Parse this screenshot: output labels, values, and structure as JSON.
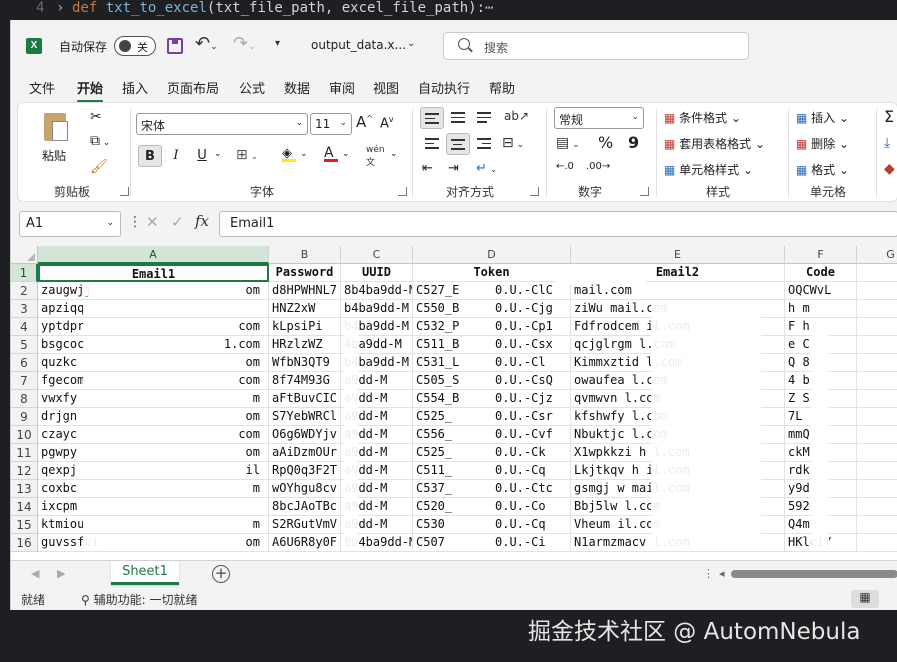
{
  "code": {
    "line_number": "4",
    "keyword": "def",
    "function": "txt_to_excel",
    "params": "(txt_file_path, excel_file_path):",
    "ellipsis": "⋯"
  },
  "titlebar": {
    "autosave_label": "自动保存",
    "toggle_state": "关",
    "filename": "output_data.x...",
    "search_placeholder": "搜索"
  },
  "tabs": [
    "文件",
    "开始",
    "插入",
    "页面布局",
    "公式",
    "数据",
    "审阅",
    "视图",
    "自动执行",
    "帮助"
  ],
  "active_tab": "开始",
  "ribbon": {
    "clipboard": {
      "paste": "粘贴",
      "group": "剪贴板"
    },
    "font": {
      "name": "宋体",
      "size": "11",
      "group": "字体",
      "bold": "B",
      "italic": "I",
      "underline": "U",
      "grow": "A",
      "shrink": "A",
      "wen": "wén"
    },
    "alignment": {
      "group": "对齐方式"
    },
    "number": {
      "format": "常规",
      "percent": "%",
      "comma": "9",
      "group": "数字"
    },
    "styles": {
      "conditional": "条件格式",
      "table": "套用表格格式",
      "cell_styles": "单元格样式",
      "group": "样式"
    },
    "cells": {
      "insert": "插入",
      "delete": "删除",
      "format": "格式",
      "group": "单元格"
    },
    "editing": {
      "sum": "Σ"
    }
  },
  "formula_bar": {
    "name_box": "A1",
    "fx": "fx",
    "formula": "Email1"
  },
  "columns": [
    "A",
    "B",
    "C",
    "D",
    "E",
    "F",
    "G"
  ],
  "header_row": [
    "Email1",
    "Password",
    "UUID",
    "Token",
    "Email2",
    "Code"
  ],
  "rows": [
    {
      "n": "2",
      "a": "zaugwjj",
      "a_end": "om",
      "b": "d8HPWHNL7",
      "c": "8b4ba9dd-M",
      "d": "C527_E",
      "d2": "0.U.-ClC",
      "e": "mail.com",
      "f": "OQCWvL"
    },
    {
      "n": "3",
      "a": "apziqq",
      "a_end": "",
      "b": "HNZ2xW",
      "c": "b4ba9dd-M",
      "d": "C550_B",
      "d2": "0.U.-Cjg",
      "e": "ziWu mail.com",
      "f": "h m"
    },
    {
      "n": "4",
      "a": "yptdpr",
      "a_end": "com",
      "b": "kLpsiPi",
      "c": "b4ba9dd-M",
      "d": "C532_P",
      "d2": "0.U.-Cp1",
      "e": "Fdfrodcem il.com",
      "f": "F h"
    },
    {
      "n": "5",
      "a": "bsgcoc",
      "a_end": "1.com",
      "b": "HRzlzWZ",
      "c": "4ba9dd-M",
      "d": "C511_B",
      "d2": "0.U.-Csx",
      "e": "qcjglrgm l.com",
      "f": "e C"
    },
    {
      "n": "6",
      "a": "quzkc",
      "a_end": "om",
      "b": "WfbN3QT9",
      "c": "b4ba9dd-M",
      "d": "C531_L",
      "d2": "0.U.-Cl",
      "e": "Kimmxztid l.com",
      "f": "Q 8"
    },
    {
      "n": "7",
      "a": "fgecom",
      "a_end": "com",
      "b": "8f74M93G",
      "c": "a9dd-M",
      "d": "C505_S",
      "d2": "0.U.-CsQ",
      "e": "owaufea l.com",
      "f": "4 b"
    },
    {
      "n": "8",
      "a": "vwxfy",
      "a_end": "m",
      "b": "aFtBuvCIC",
      "c": "a9dd-M",
      "d": "C554_B",
      "d2": "0.U.-Cjz",
      "e": "qvmwvn l.com",
      "f": "Z S"
    },
    {
      "n": "9",
      "a": "drjgn",
      "a_end": "om",
      "b": "S7YebWRCl",
      "c": "a9dd-M",
      "d": "C525_",
      "d2": "0.U.-Csr",
      "e": "kfshwfy l.com",
      "f": "7L"
    },
    {
      "n": "10",
      "a": "czayc",
      "a_end": "com",
      "b": "O6g6WDYjv",
      "c": "a9dd-M",
      "d": "C556_",
      "d2": "0.U.-Cvf",
      "e": "Nbuktjc l.com",
      "f": "mmQ"
    },
    {
      "n": "11",
      "a": "pgwpy",
      "a_end": "om",
      "b": "aAiDzmOUr",
      "c": "a9dd-M",
      "d": "C525_",
      "d2": "0.U.-Ck",
      "e": "X1wpkkzi h l.com",
      "f": "ckM"
    },
    {
      "n": "12",
      "a": "qexpj",
      "a_end": "il",
      "b": "RpQ0q3F2T",
      "c": "a9dd-M",
      "d": "C511_",
      "d2": "0.U.-Cq",
      "e": "Lkjtkqv h il.com",
      "f": "rdk"
    },
    {
      "n": "13",
      "a": "coxbc",
      "a_end": "m",
      "b": "wOYhgu8cv",
      "c": "a9dd-M",
      "d": "C537_",
      "d2": "0.U.-Ctc",
      "e": "gsmgj w mail.com",
      "f": "y9d"
    },
    {
      "n": "14",
      "a": "ixcpm",
      "a_end": "",
      "b": "8bcJAoTBc",
      "c": "a9dd-M",
      "d": "C520_",
      "d2": "0.U.-Co",
      "e": "Bbj5lw l.com",
      "f": "592"
    },
    {
      "n": "15",
      "a": "ktmiou",
      "a_end": "m",
      "b": "S2RGutVmV",
      "c": "a9dd-M",
      "d": "C530",
      "d2": "0.U.-Cq",
      "e": "Vheum il.com",
      "f": "Q4m"
    },
    {
      "n": "16",
      "a": "guvssfvi",
      "a_end": "om",
      "b": "A6U6R8y0F",
      "c": "8b4ba9dd-M",
      "d": "C507",
      "d2": "0.U.-Ci",
      "e": "N1armzmacv l.com",
      "f": "HKlciY"
    }
  ],
  "sheet": {
    "tab": "Sheet1",
    "add": "+"
  },
  "status": {
    "ready": "就绪",
    "accessibility": "辅助功能: 一切就绪"
  },
  "watermark": "掘金技术社区 @ AutomNebula",
  "colors": {
    "accent": "#1d7a43",
    "selection": "#d3e4d8"
  }
}
